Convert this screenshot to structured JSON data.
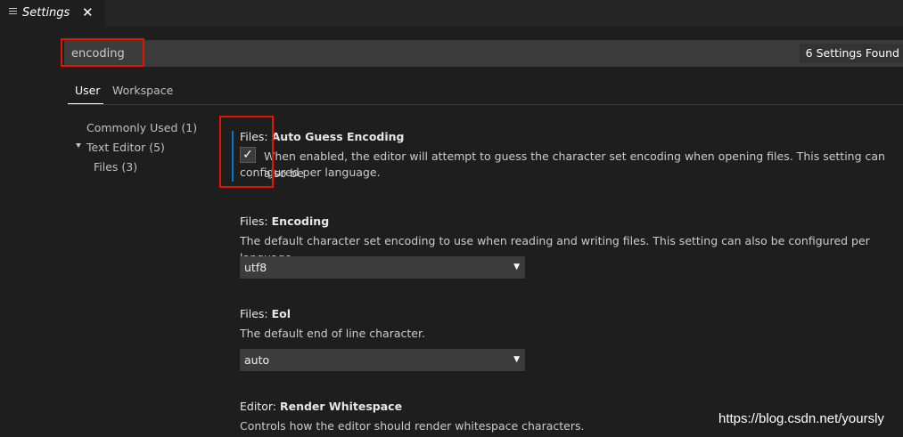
{
  "tab": {
    "title": "Settings",
    "close": "✕",
    "icon": "list-icon"
  },
  "search": {
    "value": "encoding",
    "results_badge": "6 Settings Found"
  },
  "scopes": [
    "User",
    "Workspace"
  ],
  "toc": [
    {
      "label": "Commonly Used (1)"
    },
    {
      "label": "Text Editor (5)",
      "expanded": true
    },
    {
      "label": "Files (3)"
    }
  ],
  "settings": [
    {
      "category": "Files: ",
      "name": "Auto Guess Encoding",
      "description_line1": "When enabled, the editor will attempt to guess the character set encoding when opening files. This setting can also be",
      "description_line2": "configured per language.",
      "checked": true,
      "check_glyph": "✓"
    },
    {
      "category": "Files: ",
      "name": "Encoding",
      "description": "The default character set encoding to use when reading and writing files. This setting can also be configured per language.",
      "value": "utf8"
    },
    {
      "category": "Files: ",
      "name": "Eol",
      "description": "The default end of line character.",
      "value": "auto"
    },
    {
      "category": "Editor: ",
      "name": "Render Whitespace",
      "description": "Controls how the editor should render whitespace characters."
    }
  ],
  "watermark": "https://blog.csdn.net/yoursly",
  "colors": {
    "accent": "#007acc",
    "highlight": "#e51400",
    "background": "#1e1e1e"
  }
}
